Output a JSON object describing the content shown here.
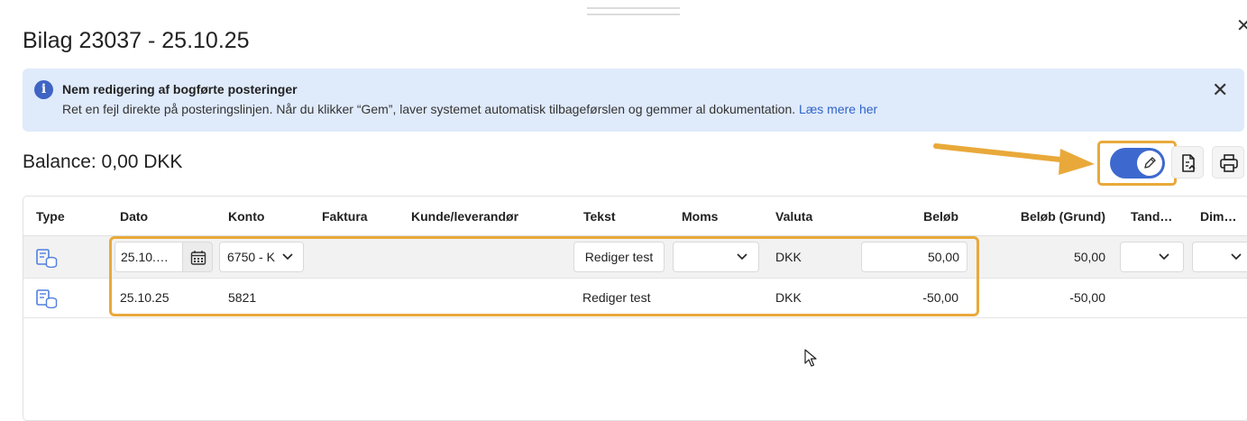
{
  "dialog": {
    "title": "Bilag 23037 - 25.10.25"
  },
  "banner": {
    "title": "Nem redigering af bogførte posteringer",
    "text": "Ret en fejl direkte på posteringslinjen. Når du klikker “Gem”, laver systemet automatisk tilbageførslen og gemmer al dokumentation.",
    "link": "Læs mere her"
  },
  "balance": "Balance: 0,00 DKK",
  "toolbar": {
    "edit_toggle_on": true,
    "icons": [
      "pencil-icon",
      "document-export-icon",
      "printer-icon"
    ]
  },
  "table": {
    "columns": [
      "Type",
      "Dato",
      "Konto",
      "Faktura",
      "Kunde/leverandør",
      "Tekst",
      "Moms",
      "Valuta",
      "Beløb",
      "Beløb (Grund)",
      "Tand…",
      "Dim…"
    ],
    "rows": [
      {
        "type_icon": "ledger-coins-icon",
        "dato": "25.10.…",
        "konto": "6750 - K",
        "faktura": "",
        "kunde": "",
        "tekst": "Rediger test",
        "moms": "",
        "valuta": "DKK",
        "belob": "50,00",
        "belob_grund": "50,00"
      },
      {
        "type_icon": "ledger-coins-icon",
        "dato": "25.10.25",
        "konto": "5821",
        "faktura": "",
        "kunde": "",
        "tekst": "Rediger test",
        "moms": "",
        "valuta": "DKK",
        "belob": "-50,00",
        "belob_grund": "-50,00"
      }
    ]
  },
  "colors": {
    "accent": "#3d69cf",
    "highlight": "#e9a93a",
    "banner_bg": "#dfeafb",
    "link": "#2f64c9"
  }
}
